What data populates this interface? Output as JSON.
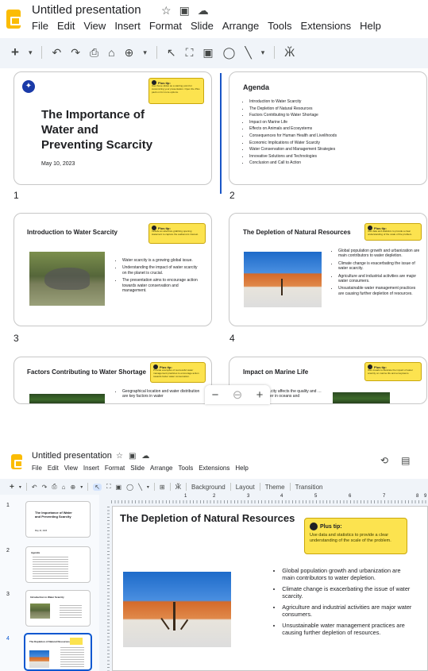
{
  "top": {
    "title": "Untitled presentation",
    "menu": [
      "File",
      "Edit",
      "View",
      "Insert",
      "Format",
      "Slide",
      "Arrange",
      "Tools",
      "Extensions",
      "Help"
    ],
    "toolbar_icons": [
      "+",
      "▾",
      "↶",
      "↷",
      "⎙",
      "⌂",
      "⊕",
      "▾",
      "↖",
      "⛶",
      "▣",
      "◯",
      "╲",
      "▾",
      "Ӂ"
    ]
  },
  "grid": {
    "slides": [
      {
        "num": "1",
        "title": "The Importance of Water and Preventing Scarcity",
        "date": "May 10, 2023",
        "tip_title": "Plus tip:",
        "tip_text": "Use these slides as a starting point for customizing your presentation. Open the Plus pack on for more options."
      },
      {
        "num": "2",
        "title": "Agenda",
        "items": [
          "Introduction to Water Scarcity",
          "The Depletion of Natural Resources",
          "Factors Contributing to Water Shortage",
          "Impact on Marine Life",
          "Effects on Animals and Ecosystems",
          "Consequences for Human Health and Livelihoods",
          "Economic Implications of Water Scarcity",
          "Water Conservation and Management Strategies",
          "Innovative Solutions and Technologies",
          "Conclusion and Call to Action"
        ]
      },
      {
        "num": "3",
        "title": "Introduction to Water Scarcity",
        "tip_title": "Plus tip:",
        "tip_text": "Include an attention-grabbing opening statement to capture the audience's interest.",
        "items": [
          "Water scarcity is a growing global issue.",
          "Understanding the impact of water scarcity on the planet is crucial.",
          "The presentation aims to encourage action towards water conservation and management."
        ]
      },
      {
        "num": "4",
        "title": "The Depletion of Natural Resources",
        "tip_title": "Plus tip:",
        "tip_text": "Use data and statistics to provide a clear understanding of the scale of the problem.",
        "items": [
          "Global population growth and urbanization are main contributors to water depletion.",
          "Climate change is exacerbating the issue of water scarcity.",
          "Agriculture and industrial activities are major water consumers.",
          "Unsustainable water management practices are causing further depletion of resources."
        ]
      },
      {
        "title": "Factors Contributing to Water Shortage",
        "tip_title": "Plus tip:",
        "tip_text": "Provide examples of successful water management practices to encourage action towards better water conservation.",
        "items": [
          "Geographical location and water distribution are key factors in water"
        ]
      },
      {
        "title": "Impact on Marine Life",
        "tip_title": "Plus tip:",
        "tip_text": "Use visuals to illustrate the impact of water scarcity on marine life and ecosystems.",
        "items": [
          "…city affects the quality and …ater in oceans and"
        ]
      }
    ],
    "zoom": [
      "−",
      "⊖",
      "+"
    ]
  },
  "bottom": {
    "title": "Untitled presentation",
    "menu": [
      "File",
      "Edit",
      "View",
      "Insert",
      "Format",
      "Slide",
      "Arrange",
      "Tools",
      "Extensions",
      "Help"
    ],
    "toolbar_labels": [
      "Background",
      "Layout",
      "Theme",
      "Transition"
    ],
    "ruler": [
      "1",
      "2",
      "3",
      "4",
      "5",
      "6",
      "7",
      "8",
      "9"
    ],
    "thumbs": [
      {
        "num": "1",
        "title": "The Importance of Water and Preventing Scarcity",
        "date": "May 10, 2023"
      },
      {
        "num": "2",
        "title": "Agenda"
      },
      {
        "num": "3",
        "title": "Introduction to Water Scarcity"
      },
      {
        "num": "4",
        "title": "The Depletion of Natural Resources"
      }
    ],
    "main": {
      "title": "The Depletion of Natural Resources",
      "tip_title": "Plus tip:",
      "tip_text": "Use data and statistics to provide a clear understanding of the scale of the problem.",
      "items": [
        "Global population growth and urbanization are main contributors to water depletion.",
        "Climate change is exacerbating the issue of water scarcity.",
        "Agriculture and industrial activities are major water consumers.",
        "Unsustainable water management practices are causing further depletion of resources."
      ]
    }
  }
}
